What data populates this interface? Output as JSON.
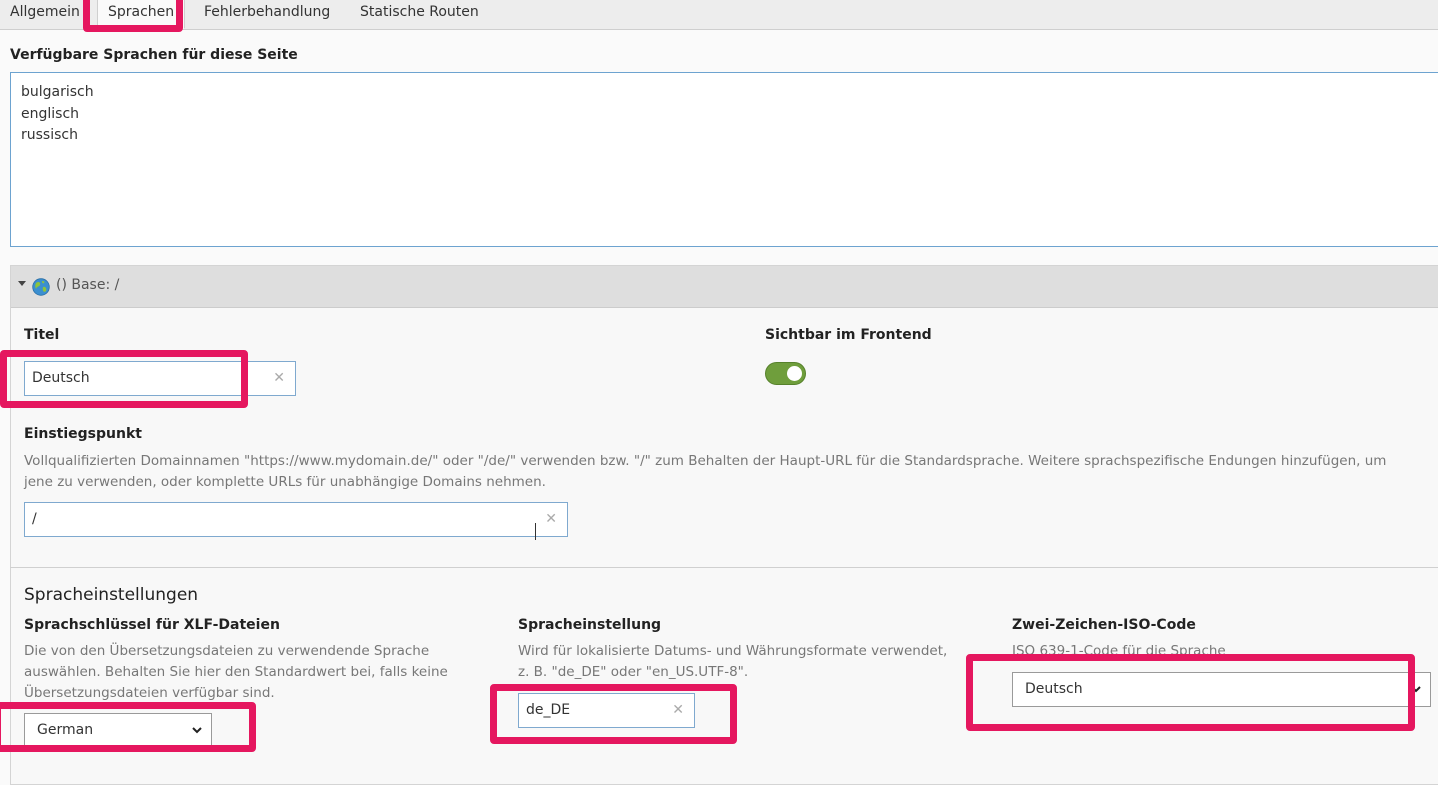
{
  "tabs": [
    "Allgemein",
    "Sprachen",
    "Fehlerbehandlung",
    "Statische Routen"
  ],
  "available_languages": {
    "label": "Verfügbare Sprachen für diese Seite",
    "items": [
      "bulgarisch",
      "englisch",
      "russisch"
    ]
  },
  "panel": {
    "header": "() Base: /",
    "titel": {
      "label": "Titel",
      "value": "Deutsch"
    },
    "visible": {
      "label": "Sichtbar im Frontend",
      "enabled": true
    },
    "entry": {
      "label": "Einstiegspunkt",
      "help_line1": "Vollqualifizierten Domainnamen \"https://www.mydomain.de/\" oder \"/de/\" verwenden bzw. \"/\" zum Behalten der Haupt-URL für die Standardsprache. Weitere sprachspezifische Endungen hinzufügen, um",
      "help_line2": "jene zu verwenden, oder komplette URLs für unabhängige Domains nehmen.",
      "value": "/"
    },
    "lang_settings": {
      "title": "Spracheinstellungen",
      "xlf": {
        "label": "Sprachschlüssel für XLF-Dateien",
        "help_line1": "Die von den Übersetzungsdateien zu verwendende Sprache",
        "help_line2": "auswählen. Behalten Sie hier den Standardwert bei, falls keine",
        "help_line3": "Übersetzungsdateien verfügbar sind.",
        "value": "German"
      },
      "locale": {
        "label": "Spracheinstellung",
        "help_line1": "Wird für lokalisierte Datums- und Währungsformate verwendet,",
        "help_line2": "z. B. \"de_DE\" oder \"en_US.UTF-8\".",
        "value": "de_DE"
      },
      "iso": {
        "label": "Zwei-Zeichen-ISO-Code",
        "help": "ISO 639-1-Code für die Sprache",
        "value": "Deutsch"
      }
    }
  },
  "colors": {
    "highlight": "#e5175f",
    "toggle_on": "#6f9e3c",
    "input_border": "#7fa9cf"
  }
}
